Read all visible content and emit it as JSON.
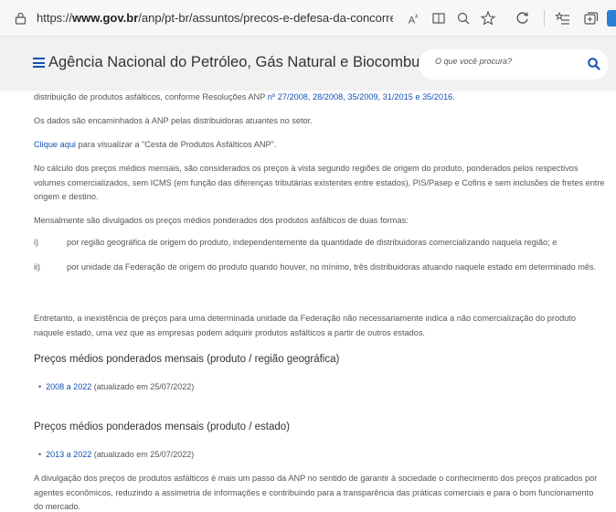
{
  "browser": {
    "url_prefix": "https://",
    "url_domain": "www.gov.br",
    "url_path": "/anp/pt-br/assuntos/precos-e-defesa-da-concorrencia/precos/pr..."
  },
  "header": {
    "agency": "Agência Nacional do Petróleo, Gás Natural e Biocombustíveis",
    "search_placeholder": "O que você procura?"
  },
  "content": {
    "p0_text": "distribuição de produtos asfálticos, conforme Resoluções ANP ",
    "p0_links": "nº 27/2008, 28/2008, 35/2009, 31/2015 e 35/2016",
    "p0_end": ".",
    "p1": "Os dados são encaminhados à ANP pelas distribuidoras atuantes no setor.",
    "p2_link": "Clique aqui",
    "p2_text": " para visualizar a \"Cesta de Produtos Asfálticos ANP\".",
    "p3": "No cálculo dos preços médios mensais, são considerados os preços à vista segundo regiões de origem do produto, ponderados pelos respectivos volumes comercializados, sem ICMS (em função das diferenças tributárias existentes entre estados), PIS/Pasep e Cofins e sem inclusões de fretes entre origem e destino.",
    "p4": "Mensalmente são divulgados os preços médios ponderados dos produtos asfálticos de duas formas:",
    "list": [
      {
        "marker": "i)",
        "text": "por região geográfica de origem do produto, independentemente da quantidade de distribuidoras comercializando naquela região; e"
      },
      {
        "marker": "ii)",
        "text": "por unidade da Federação de origem do produto quando houver, no mínimo, três distribuidoras atuando naquele estado em determinado mês."
      }
    ],
    "p5": "Entretanto, a inexistência de preços para uma determinada unidade da Federação não necessariamente indica a não comercialização do produto naquele estado, uma vez que as empresas podem adquirir produtos asfálticos a partir de outros estados.",
    "h1": "Preços médios ponderados mensais (produto / região geográfica)",
    "h1_link": "2008 a 2022",
    "h1_note": " (atualizado em 25/07/2022)",
    "h2": "Preços médios ponderados mensais (produto / estado)",
    "h2_link": "2013 a 2022",
    "h2_note": " (atualizado em 25/07/2022)",
    "p6": "A divulgação dos preços de produtos asfálticos é mais um passo da ANP no sentido de garantir à sociedade o conhecimento dos preços praticados por agentes econômicos, reduzindo a assimetria de informações e contribuindo para a transparência das práticas comerciais e para o bom funcionamento do mercado."
  },
  "colors": {
    "link": "#1351b4",
    "text": "#555555",
    "header_bg": "#f1f1f1"
  }
}
